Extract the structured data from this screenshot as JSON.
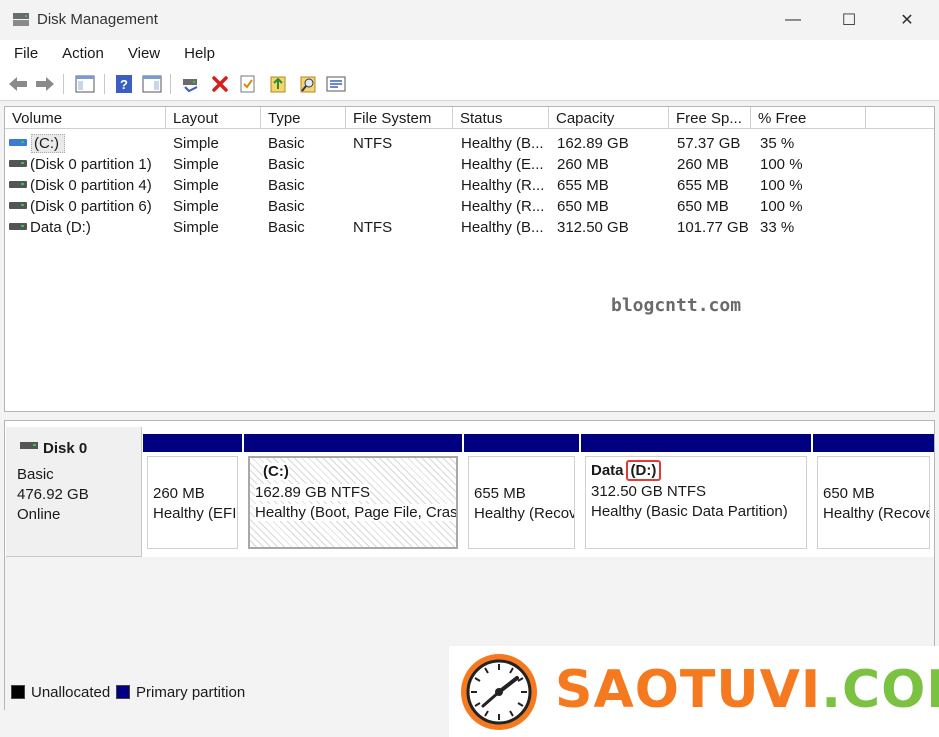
{
  "window": {
    "title": "Disk Management",
    "minimize_glyph": "—",
    "maximize_glyph": "☐",
    "close_glyph": "✕"
  },
  "menu": [
    "File",
    "Action",
    "View",
    "Help"
  ],
  "toolbar_icons": [
    "back-arrow-icon",
    "forward-arrow-icon",
    "console-tree-icon",
    "help-icon",
    "properties-pane-icon",
    "connect-icon",
    "delete-icon",
    "check-icon",
    "export-icon",
    "find-icon",
    "details-icon"
  ],
  "columns": [
    "Volume",
    "Layout",
    "Type",
    "File System",
    "Status",
    "Capacity",
    "Free Sp...",
    "% Free"
  ],
  "volumes": [
    {
      "name": "(C:)",
      "layout": "Simple",
      "type": "Basic",
      "fs": "NTFS",
      "status": "Healthy (B...",
      "capacity": "162.89 GB",
      "free": "57.37 GB",
      "pct": "35 %",
      "icon_color": "#3a7bd5"
    },
    {
      "name": "(Disk 0 partition 1)",
      "layout": "Simple",
      "type": "Basic",
      "fs": "",
      "status": "Healthy (E...",
      "capacity": "260 MB",
      "free": "260 MB",
      "pct": "100 %",
      "icon_color": "#555555"
    },
    {
      "name": "(Disk 0 partition 4)",
      "layout": "Simple",
      "type": "Basic",
      "fs": "",
      "status": "Healthy (R...",
      "capacity": "655 MB",
      "free": "655 MB",
      "pct": "100 %",
      "icon_color": "#555555"
    },
    {
      "name": "(Disk 0 partition 6)",
      "layout": "Simple",
      "type": "Basic",
      "fs": "",
      "status": "Healthy (R...",
      "capacity": "650 MB",
      "free": "650 MB",
      "pct": "100 %",
      "icon_color": "#555555"
    },
    {
      "name": "Data (D:)",
      "layout": "Simple",
      "type": "Basic",
      "fs": "NTFS",
      "status": "Healthy (B...",
      "capacity": "312.50 GB",
      "free": "101.77 GB",
      "pct": "33 %",
      "icon_color": "#555555"
    }
  ],
  "watermark": "blogcntt.com",
  "disk": {
    "name": "Disk 0",
    "type": "Basic",
    "size": "476.92 GB",
    "state": "Online"
  },
  "partitions": [
    {
      "title": "",
      "title_suffix": "",
      "line1": "260 MB",
      "line2": "Healthy (EFI"
    },
    {
      "title": "(C:)",
      "title_suffix": "",
      "line1": "162.89 GB NTFS",
      "line2": "Healthy (Boot, Page File, Crash"
    },
    {
      "title": "",
      "title_suffix": "",
      "line1": "655 MB",
      "line2": "Healthy (Recov"
    },
    {
      "title": "Data",
      "title_suffix": "(D:)",
      "line1": "312.50 GB NTFS",
      "line2": "Healthy (Basic Data Partition)"
    },
    {
      "title": "",
      "title_suffix": "",
      "line1": "650 MB",
      "line2": "Healthy (Recove"
    }
  ],
  "legend": [
    {
      "label": "Unallocated",
      "color": "#000000"
    },
    {
      "label": "Primary partition",
      "color": "#000080"
    }
  ],
  "brand": {
    "part1": "SAOTUVI",
    "part2": ".COM",
    "color1": "#f4791f",
    "color2": "#7cc242"
  }
}
